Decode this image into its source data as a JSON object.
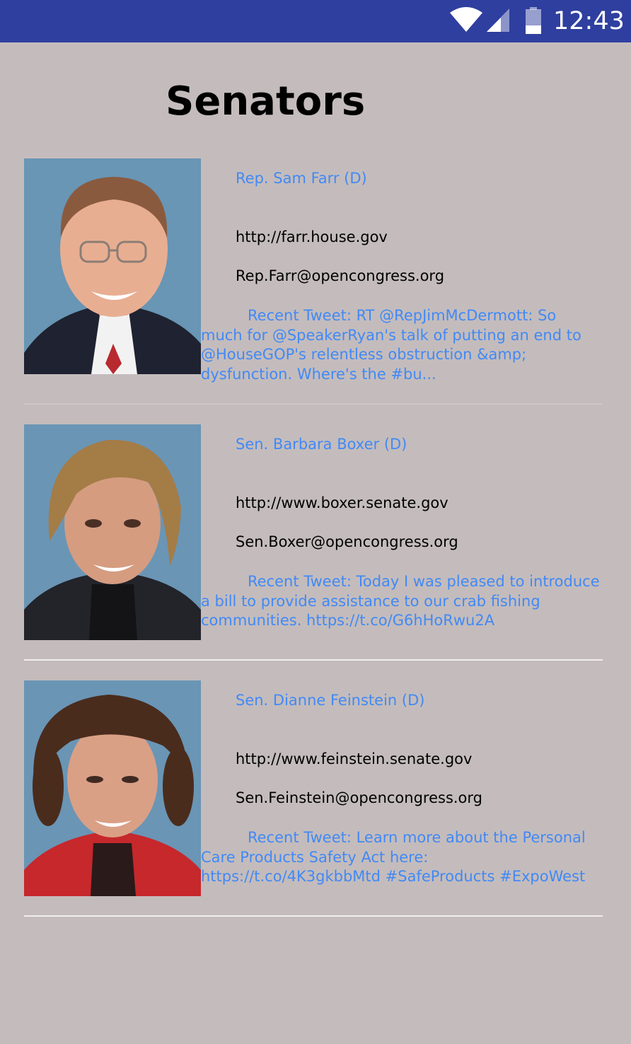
{
  "status_bar": {
    "time": "12:43",
    "bg_color": "#2f3f9f",
    "icons": [
      "wifi-icon",
      "cell-signal-icon",
      "battery-icon"
    ]
  },
  "page": {
    "title": "Senators",
    "bg_color": "#c4bcbc",
    "accent_color": "#4289f5"
  },
  "legislators": [
    {
      "name": "Rep. Sam Farr (D)",
      "url": "http://farr.house.gov",
      "email": "Rep.Farr@opencongress.org",
      "tweet": "Recent Tweet: RT @RepJimMcDermott: So much for @SpeakerRyan's talk of putting an end to @HouseGOP's relentless obstruction &amp; dysfunction. Where's the #bu..."
    },
    {
      "name": "Sen. Barbara Boxer (D)",
      "url": "http://www.boxer.senate.gov",
      "email": "Sen.Boxer@opencongress.org",
      "tweet": "Recent Tweet: Today I was pleased to introduce a bill to provide assistance to our crab fishing communities. https://t.co/G6hHoRwu2A"
    },
    {
      "name": "Sen. Dianne Feinstein (D)",
      "url": "http://www.feinstein.senate.gov",
      "email": "Sen.Feinstein@opencongress.org",
      "tweet": "Recent Tweet: Learn more about the Personal Care Products Safety Act here: https://t.co/4K3gkbbMtd #SafeProducts #ExpoWest"
    }
  ]
}
